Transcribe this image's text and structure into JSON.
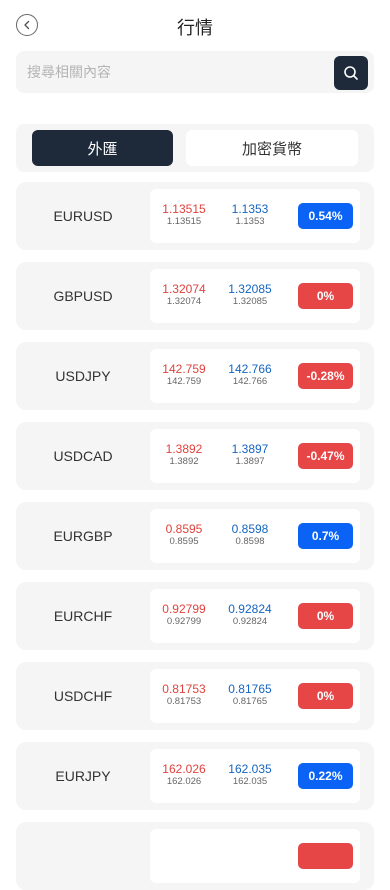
{
  "header": {
    "title": "行情",
    "back_icon": "chevron-left-icon"
  },
  "search": {
    "placeholder": "搜尋相關內容",
    "value": "",
    "icon": "search-icon"
  },
  "tabs": [
    {
      "label": "外匯",
      "active": true
    },
    {
      "label": "加密貨幣",
      "active": false
    }
  ],
  "colors": {
    "up": "#0b63f6",
    "down": "#e64646",
    "bid": "#e0433d",
    "ask": "#1565c0",
    "dark": "#1e2a3a"
  },
  "quotes": [
    {
      "symbol": "EURUSD",
      "bid": "1.13515",
      "bid_sub": "1.13515",
      "ask": "1.1353",
      "ask_sub": "1.1353",
      "change": "0.54%",
      "direction": "up"
    },
    {
      "symbol": "GBPUSD",
      "bid": "1.32074",
      "bid_sub": "1.32074",
      "ask": "1.32085",
      "ask_sub": "1.32085",
      "change": "0%",
      "direction": "down"
    },
    {
      "symbol": "USDJPY",
      "bid": "142.759",
      "bid_sub": "142.759",
      "ask": "142.766",
      "ask_sub": "142.766",
      "change": "-0.28%",
      "direction": "down"
    },
    {
      "symbol": "USDCAD",
      "bid": "1.3892",
      "bid_sub": "1.3892",
      "ask": "1.3897",
      "ask_sub": "1.3897",
      "change": "-0.47%",
      "direction": "down"
    },
    {
      "symbol": "EURGBP",
      "bid": "0.8595",
      "bid_sub": "0.8595",
      "ask": "0.8598",
      "ask_sub": "0.8598",
      "change": "0.7%",
      "direction": "up"
    },
    {
      "symbol": "EURCHF",
      "bid": "0.92799",
      "bid_sub": "0.92799",
      "ask": "0.92824",
      "ask_sub": "0.92824",
      "change": "0%",
      "direction": "down"
    },
    {
      "symbol": "USDCHF",
      "bid": "0.81753",
      "bid_sub": "0.81753",
      "ask": "0.81765",
      "ask_sub": "0.81765",
      "change": "0%",
      "direction": "down"
    },
    {
      "symbol": "EURJPY",
      "bid": "162.026",
      "bid_sub": "162.026",
      "ask": "162.035",
      "ask_sub": "162.035",
      "change": "0.22%",
      "direction": "up"
    },
    {
      "symbol": "",
      "bid": "",
      "bid_sub": "",
      "ask": "",
      "ask_sub": "",
      "change": "",
      "direction": "down"
    }
  ]
}
